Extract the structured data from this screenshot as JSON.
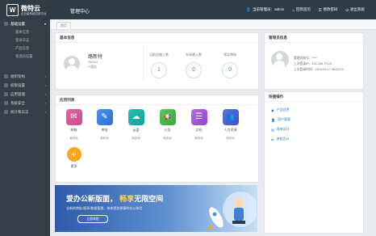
{
  "header": {
    "logo_mark": "W",
    "logo_name": "微特云",
    "logo_sub": "企业级系统应用平台",
    "system_name": "管理中心",
    "user_label": "当前管理员：admin",
    "home_label": "回到首页",
    "password_label": "修改密码",
    "logout_label": "退出系统"
  },
  "sidebar": {
    "basic_settings": "基础设置",
    "items": [
      "基本信息",
      "登录日志",
      "产品信息",
      "管理员设置"
    ],
    "groups": [
      "组织架构",
      "权限设置",
      "应用管理",
      "系统安全",
      "统计和日志"
    ]
  },
  "tabs": [
    "首页"
  ],
  "basic_info": {
    "title": "基本信息",
    "name": "路新特",
    "id": "555461",
    "dept": "IT服务",
    "stats": [
      {
        "label": "当前总输入数",
        "value": "1"
      },
      {
        "label": "本周输入数",
        "value": "0"
      },
      {
        "label": "领导审核",
        "value": "0"
      }
    ]
  },
  "apps": {
    "title": "应用列表",
    "items": [
      {
        "name": "邮箱",
        "badge": "最新版",
        "icon": "mail-icon",
        "glyph": "✉",
        "color": "#d94f9a"
      },
      {
        "name": "审批",
        "badge": "最新版",
        "icon": "approval-icon",
        "glyph": "✎",
        "color": "#3b7fe0"
      },
      {
        "name": "云盘",
        "badge": "最新版",
        "icon": "cloud-icon",
        "glyph": "☁",
        "color": "#18b0a6"
      },
      {
        "name": "公告",
        "badge": "最新版",
        "icon": "announcement-icon",
        "glyph": "📢",
        "color": "#4fb84a"
      },
      {
        "name": "文档",
        "badge": "最新版",
        "icon": "document-icon",
        "glyph": "☰",
        "color": "#a55bd6"
      },
      {
        "name": "人力资源",
        "badge": "最新版",
        "icon": "people-icon",
        "glyph": "👥",
        "color": "#4a62d6"
      },
      {
        "name": "更多",
        "badge": "",
        "icon": "plus-icon",
        "glyph": "+",
        "color": "#f5a623"
      }
    ]
  },
  "admin_info": {
    "title": "管理员信息",
    "account": "管理员账号：****",
    "last_ip": "上次登录IP：121.236.79.24",
    "last_time": "上次登录时间：2018-05-17 08:52:22"
  },
  "quick_ops": {
    "title": "快捷操作",
    "items": [
      "产品信息",
      "用户管理",
      "表单设计",
      "流程设计"
    ]
  },
  "banner": {
    "headline_a": "爱办公",
    "headline_b": "新版面，",
    "headline_c": "畅享",
    "headline_d": "无限空间",
    "sub": "全新的审批/报表/数据管理，带来更加便捷的办公体验",
    "button": "立即体验"
  },
  "colors": {
    "topbar": "#2f3b45",
    "sidebar": "#343e48",
    "accent": "#1a7ad4"
  }
}
